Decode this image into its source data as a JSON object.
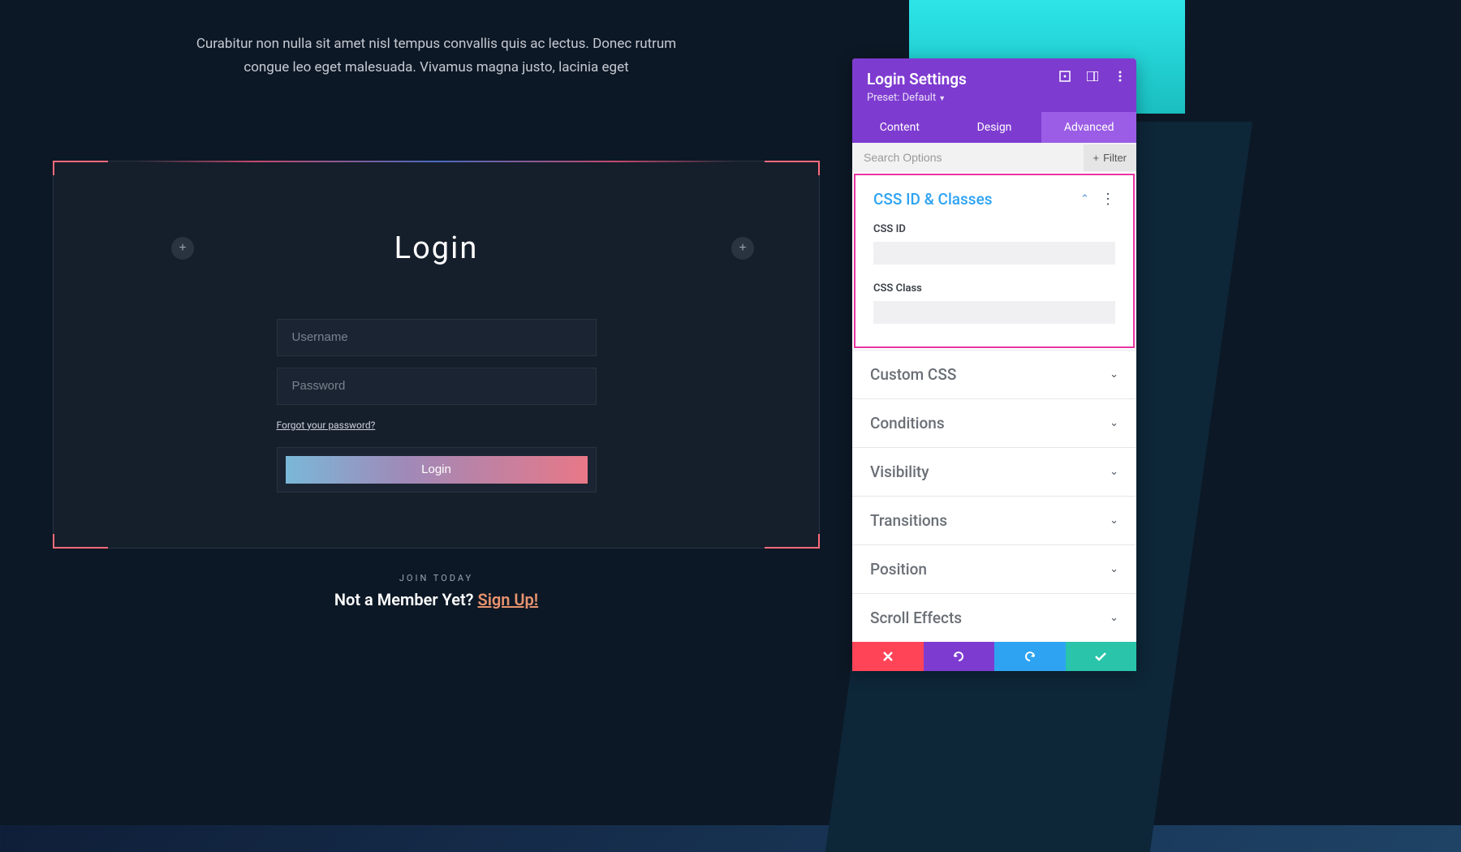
{
  "intro": "Curabitur non nulla sit amet nisl tempus convallis quis ac lectus. Donec rutrum congue leo eget malesuada. Vivamus magna justo, lacinia eget",
  "login": {
    "title": "Login",
    "username_placeholder": "Username",
    "password_placeholder": "Password",
    "forgot_link": "Forgot your password?",
    "button_label": "Login"
  },
  "join": {
    "small": "Join Today",
    "question": "Not a Member Yet? ",
    "signup": "Sign Up!"
  },
  "panel": {
    "title": "Login Settings",
    "preset": "Preset: Default",
    "tabs": {
      "content": "Content",
      "design": "Design",
      "advanced": "Advanced"
    },
    "search_placeholder": "Search Options",
    "filter_label": "Filter",
    "sections": {
      "css_id_classes": {
        "title": "CSS ID & Classes",
        "css_id_label": "CSS ID",
        "css_class_label": "CSS Class"
      },
      "custom_css": "Custom CSS",
      "conditions": "Conditions",
      "visibility": "Visibility",
      "transitions": "Transitions",
      "position": "Position",
      "scroll_effects": "Scroll Effects"
    }
  }
}
